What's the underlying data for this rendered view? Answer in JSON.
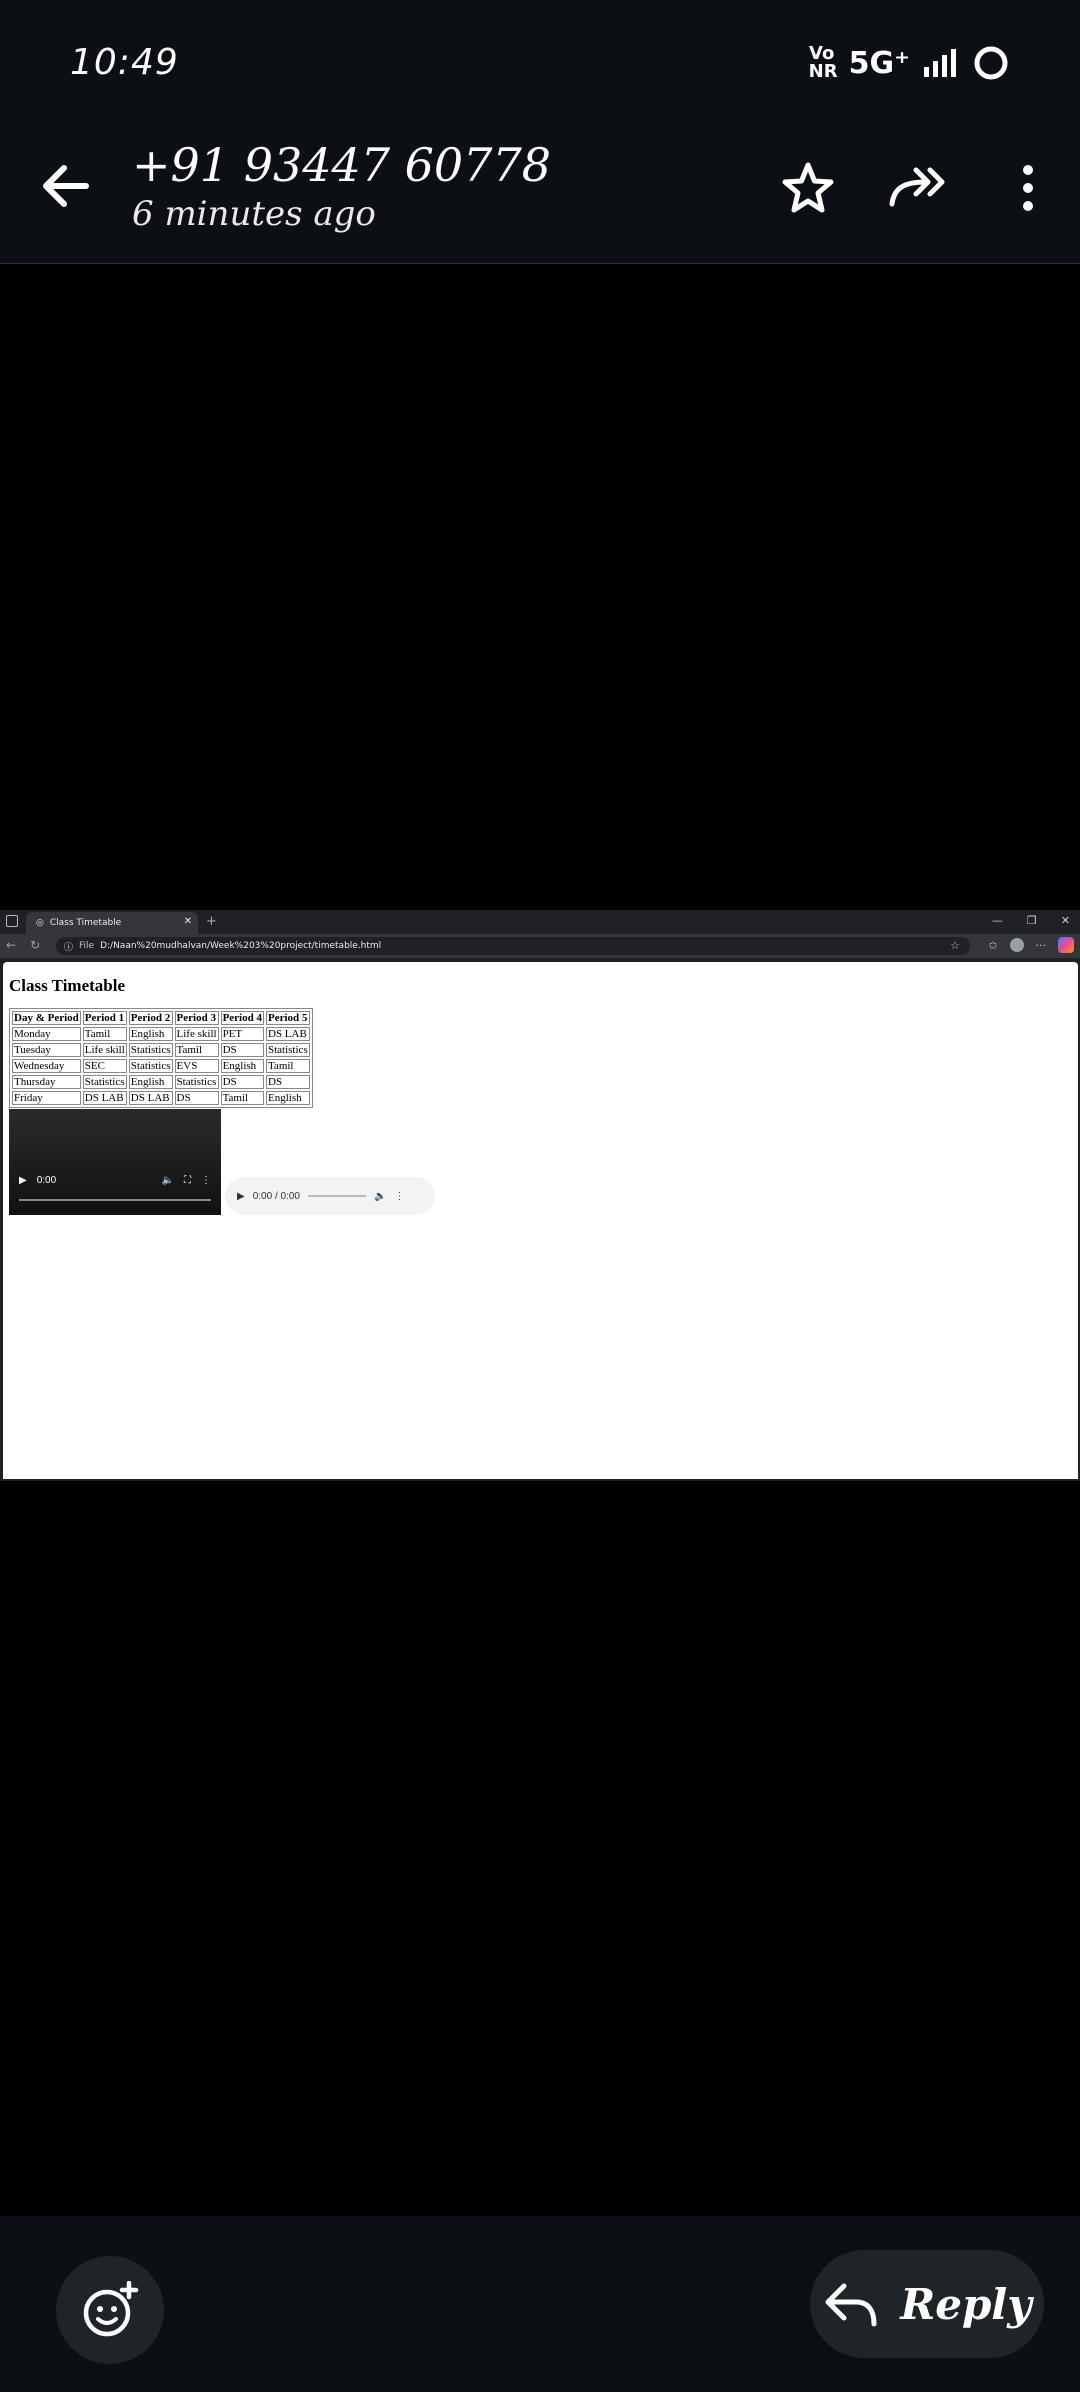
{
  "status": {
    "time": "10:49",
    "volte_top": "Vo",
    "volte_bottom": "NR",
    "network": "5G⁺"
  },
  "header": {
    "contact": "+91 93447 60778",
    "subtitle": "6 minutes ago"
  },
  "browser": {
    "tab_title": "Class Timetable",
    "address_prefix": "File",
    "address": "D:/Naan%20mudhalvan/Week%203%20project/timetable.html",
    "page_heading": "Class Timetable",
    "video_time": "0:00",
    "audio_time": "0:00 / 0:00"
  },
  "timetable": {
    "headers": [
      "Day & Period",
      "Period 1",
      "Period 2",
      "Period 3",
      "Period 4",
      "Period 5"
    ],
    "rows": [
      [
        "Monday",
        "Tamil",
        "English",
        "Life skill",
        "PET",
        "DS LAB"
      ],
      [
        "Tuesday",
        "Life skill",
        "Statistics",
        "Tamil",
        "DS",
        "Statistics"
      ],
      [
        "Wednesday",
        "SEC",
        "Statistics",
        "EVS",
        "English",
        "Tamil"
      ],
      [
        "Thursday",
        "Statistics",
        "English",
        "Statistics",
        "DS",
        "DS"
      ],
      [
        "Friday",
        "DS LAB",
        "DS LAB",
        "DS",
        "Tamil",
        "English"
      ]
    ]
  },
  "footer": {
    "reply_label": "Reply"
  }
}
